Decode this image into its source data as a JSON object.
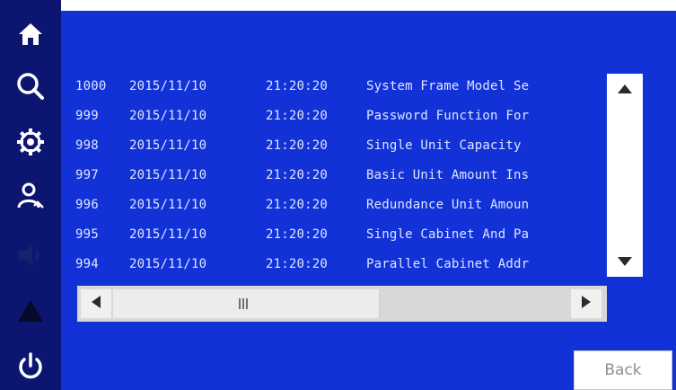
{
  "sidebar": {
    "items": [
      {
        "icon": "home-icon"
      },
      {
        "icon": "search-icon"
      },
      {
        "icon": "gear-icon"
      },
      {
        "icon": "user-icon"
      },
      {
        "icon": "speaker-icon"
      },
      {
        "icon": "warning-icon"
      },
      {
        "icon": "power-icon"
      }
    ]
  },
  "log": {
    "rows": [
      {
        "id": "1000",
        "date": "2015/11/10",
        "time": "21:20:20",
        "event": "System Frame Model Se"
      },
      {
        "id": "999",
        "date": "2015/11/10",
        "time": "21:20:20",
        "event": "Password Function For"
      },
      {
        "id": "998",
        "date": "2015/11/10",
        "time": "21:20:20",
        "event": "Single Unit Capacity "
      },
      {
        "id": "997",
        "date": "2015/11/10",
        "time": "21:20:20",
        "event": "Basic Unit Amount Ins"
      },
      {
        "id": "996",
        "date": "2015/11/10",
        "time": "21:20:20",
        "event": "Redundance Unit Amoun"
      },
      {
        "id": "995",
        "date": "2015/11/10",
        "time": "21:20:20",
        "event": "Single Cabinet And Pa"
      },
      {
        "id": "994",
        "date": "2015/11/10",
        "time": "21:20:20",
        "event": "Parallel Cabinet Addr"
      }
    ]
  },
  "footer": {
    "back_label": "Back"
  },
  "colors": {
    "sidebar_bg": "#0c1670",
    "panel_bg": "#1232d8",
    "text": "#dfe6ff"
  }
}
